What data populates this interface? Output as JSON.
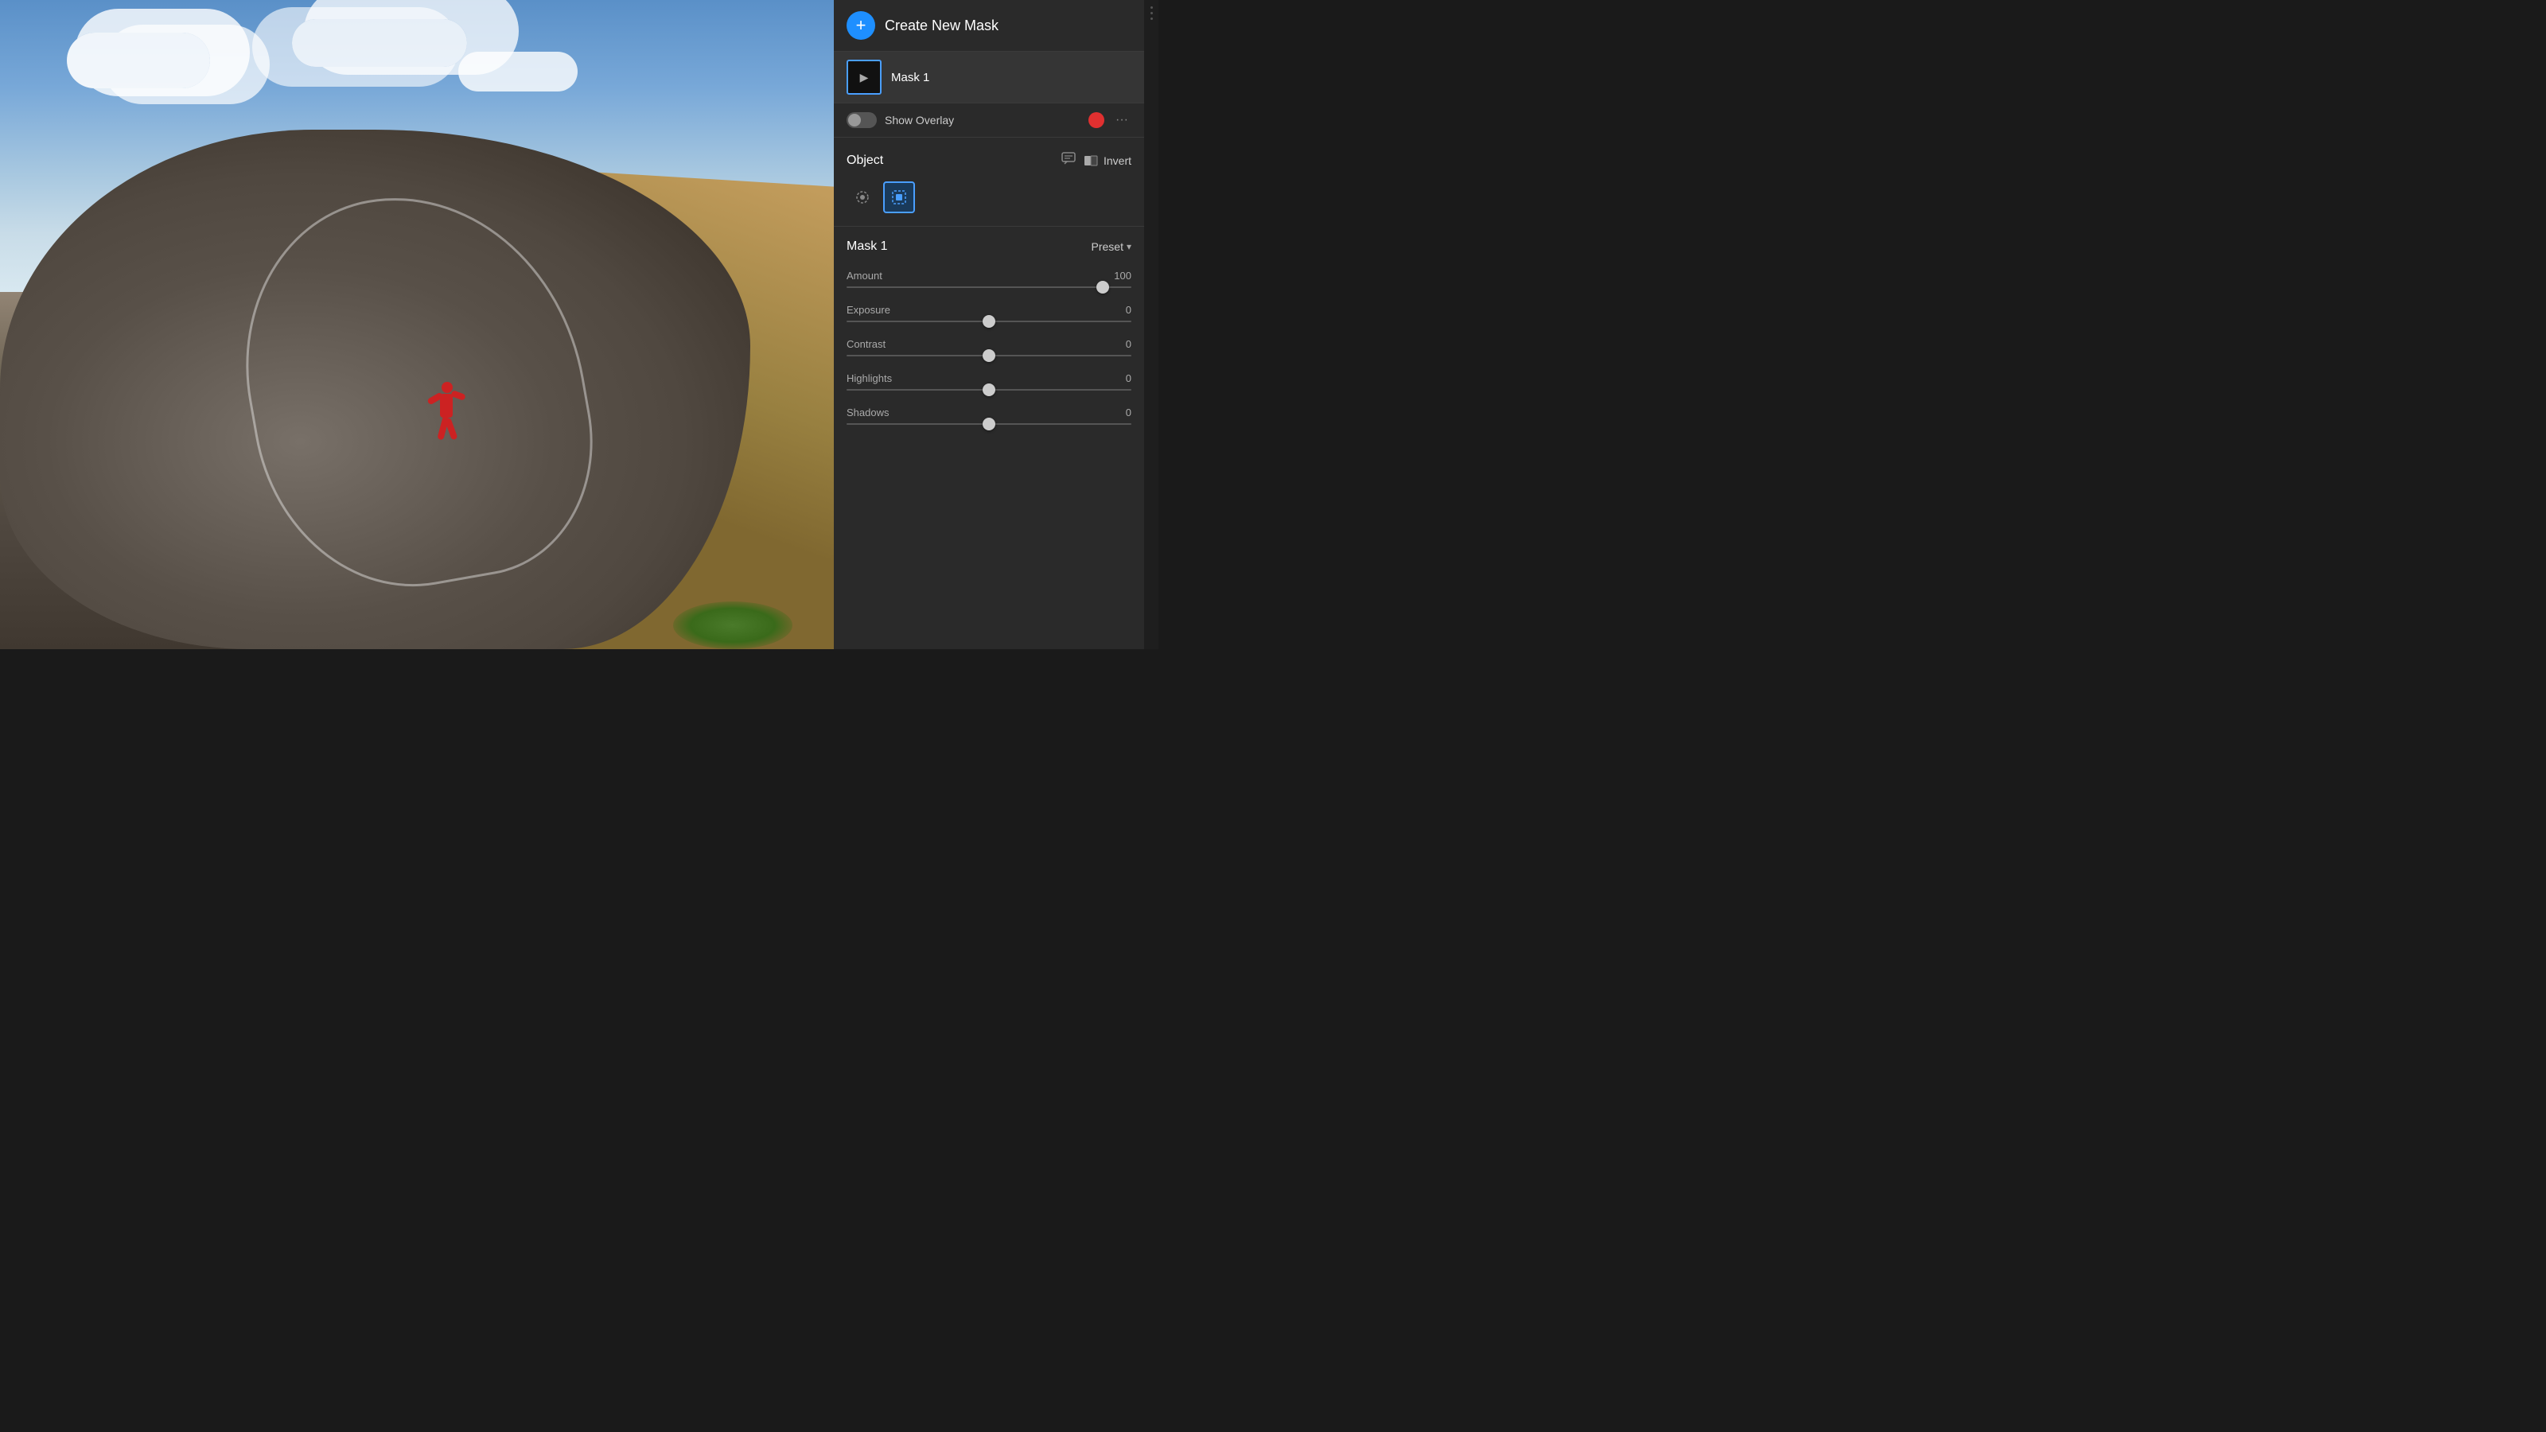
{
  "header": {
    "create_mask_label": "Create New Mask",
    "add_button_symbol": "+"
  },
  "mask": {
    "name": "Mask 1",
    "thumbnail_arrow": "▶"
  },
  "overlay": {
    "label": "Show Overlay",
    "dots": "···"
  },
  "object_section": {
    "title": "Object",
    "invert_label": "Invert"
  },
  "adjustments": {
    "title": "Mask 1",
    "preset_label": "Preset",
    "chevron": "▾",
    "sliders": [
      {
        "label": "Amount",
        "value": "100",
        "position_pct": 90
      },
      {
        "label": "Exposure",
        "value": "0",
        "position_pct": 50
      },
      {
        "label": "Contrast",
        "value": "0",
        "position_pct": 50
      },
      {
        "label": "Highlights",
        "value": "0",
        "position_pct": 50
      },
      {
        "label": "Shadows",
        "value": "0",
        "position_pct": 50
      }
    ]
  },
  "colors": {
    "accent_blue": "#1e8fff",
    "panel_bg": "#2a2a2a",
    "overlay_red": "#e03030",
    "active_tool_border": "#4a9fff",
    "active_tool_bg": "#1a3a5a"
  }
}
